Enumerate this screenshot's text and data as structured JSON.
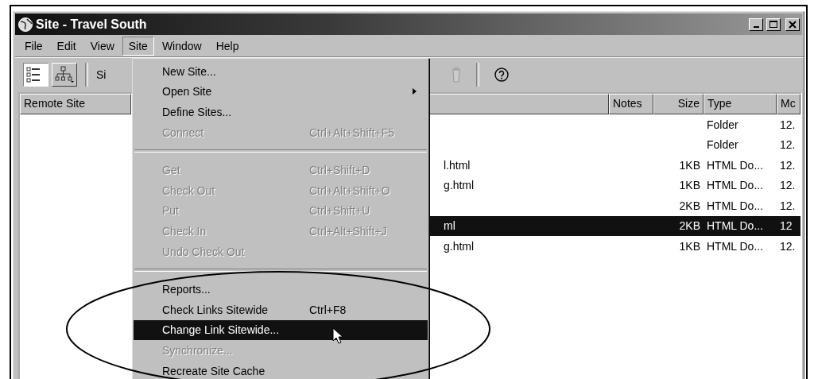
{
  "window": {
    "title": "Site - Travel South"
  },
  "menu_bar": [
    {
      "label": "File",
      "selected": false
    },
    {
      "label": "Edit",
      "selected": false
    },
    {
      "label": "View",
      "selected": false
    },
    {
      "label": "Site",
      "selected": true
    },
    {
      "label": "Window",
      "selected": false
    },
    {
      "label": "Help",
      "selected": false
    }
  ],
  "toolbar": {
    "view_buttons": [
      {
        "selected": true
      },
      {
        "selected": false
      }
    ],
    "site_label": "Si"
  },
  "left_pane": {
    "header": "Remote Site"
  },
  "right_pane": {
    "columns": [
      "Notes",
      "Size",
      "Type",
      "Mc"
    ],
    "rows": [
      {
        "type": "Folder",
        "modified": "12.",
        "selected": false
      },
      {
        "type": "Folder",
        "modified": "12.",
        "selected": false
      },
      {
        "name": "l.html",
        "size": "1KB",
        "type": "HTML Do...",
        "modified": "12.",
        "selected": false
      },
      {
        "name": "g.html",
        "size": "1KB",
        "type": "HTML Do...",
        "modified": "12.",
        "selected": false
      },
      {
        "size": "2KB",
        "type": "HTML Do...",
        "modified": "12.",
        "selected": false
      },
      {
        "name": "ml",
        "size": "2KB",
        "type": "HTML Do...",
        "modified": "12",
        "selected": true
      },
      {
        "name": "g.html",
        "size": "1KB",
        "type": "HTML Do...",
        "modified": "12.",
        "selected": false
      }
    ]
  },
  "site_menu": [
    {
      "kind": "item",
      "label": "New Site...",
      "selected": false,
      "disabled": false
    },
    {
      "kind": "submenu",
      "label": "Open Site",
      "selected": false,
      "disabled": false
    },
    {
      "kind": "item",
      "label": "Define Sites...",
      "selected": false,
      "disabled": false
    },
    {
      "kind": "item",
      "label": "Connect",
      "shortcut": "Ctrl+Alt+Shift+F5",
      "selected": false,
      "disabled": true
    },
    {
      "kind": "separator"
    },
    {
      "kind": "item",
      "label": "Get",
      "shortcut": "Ctrl+Shift+D",
      "selected": false,
      "disabled": true
    },
    {
      "kind": "item",
      "label": "Check Out",
      "shortcut": "Ctrl+Alt+Shift+O",
      "selected": false,
      "disabled": true
    },
    {
      "kind": "item",
      "label": "Put",
      "shortcut": "Ctrl+Shift+U",
      "selected": false,
      "disabled": true
    },
    {
      "kind": "item",
      "label": "Check In",
      "shortcut": "Ctrl+Alt+Shift+J",
      "selected": false,
      "disabled": true
    },
    {
      "kind": "item",
      "label": "Undo Check Out",
      "selected": false,
      "disabled": true
    },
    {
      "kind": "separator"
    },
    {
      "kind": "item",
      "label": "Reports...",
      "selected": false,
      "disabled": false
    },
    {
      "kind": "item",
      "label": "Check Links Sitewide",
      "shortcut": "Ctrl+F8",
      "selected": false,
      "disabled": false
    },
    {
      "kind": "item",
      "label": "Change Link Sitewide...",
      "selected": true,
      "disabled": false
    },
    {
      "kind": "item",
      "label": "Synchronize...",
      "selected": false,
      "disabled": true
    },
    {
      "kind": "item",
      "label": "Recreate Site Cache",
      "selected": false,
      "disabled": false
    }
  ]
}
